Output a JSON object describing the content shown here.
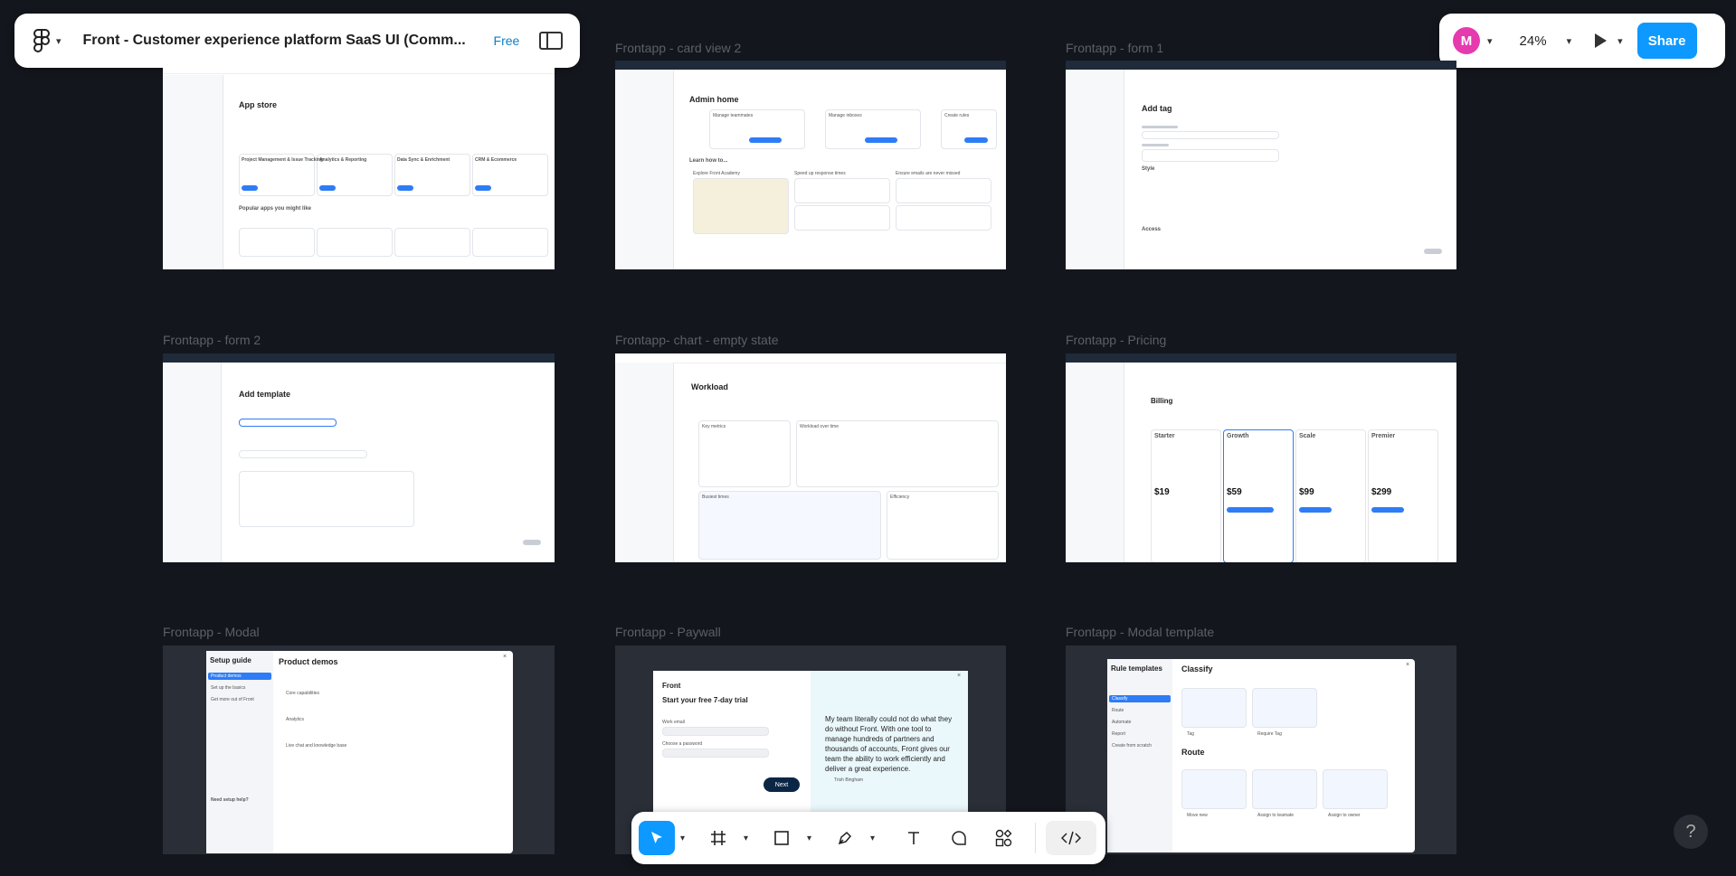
{
  "file": {
    "name": "Front - Customer experience platform SaaS UI (Comm...",
    "plan_badge": "Free"
  },
  "toolbar_right": {
    "avatar_initial": "M",
    "avatar_color": "#e63aaf",
    "zoom": "24%",
    "share_label": "Share"
  },
  "frames": [
    {
      "label": "Frontapp - card view 2"
    },
    {
      "label": "Frontapp - form 1"
    },
    {
      "label": "Frontapp - form 2"
    },
    {
      "label": "Frontapp- chart - empty state"
    },
    {
      "label": "Frontapp - Pricing"
    },
    {
      "label": "Frontapp - Modal"
    },
    {
      "label": "Frontapp - Paywall"
    },
    {
      "label": "Frontapp - Modal template"
    }
  ],
  "thumbs": {
    "app_store": {
      "title": "App store",
      "cats": [
        "Project Management & Issue Tracking",
        "Analytics & Reporting",
        "Data Sync & Enrichment",
        "CRM & Ecommerce"
      ],
      "popular": "Popular apps you might like"
    },
    "card_view": {
      "title": "Admin home",
      "cards": [
        "Manage teammates",
        "Manage inboxes",
        "Create rules"
      ],
      "learn": "Learn how to...",
      "col1": "Explore Front Academy",
      "col2": "Speed up response times",
      "col3": "Ensure emails are never missed"
    },
    "form1": {
      "title": "Add tag",
      "style": "Style",
      "access": "Access"
    },
    "form2": {
      "title": "Add template"
    },
    "chart": {
      "title": "Workload",
      "left": "Key metrics",
      "right": "Workload over time",
      "bottom1": "Busiest times",
      "bottom2": "Efficiency"
    },
    "pricing": {
      "title": "Billing",
      "plans": [
        "Starter",
        "Growth",
        "Scale",
        "Premier"
      ],
      "prices": [
        "$19",
        "$59",
        "$99",
        "$299"
      ]
    },
    "modal": {
      "side_title": "Setup guide",
      "items": [
        "Product demos",
        "Set up the basics",
        "Get more out of Front"
      ],
      "main_title": "Product demos",
      "rows": [
        "Core capabilities",
        "Analytics",
        "Live chat and knowledge base"
      ],
      "help": "Need setup help?"
    },
    "paywall": {
      "brand": "Front",
      "title": "Start your free 7-day trial",
      "work_email": "Work email",
      "choose_password": "Choose a password",
      "next": "Next",
      "quote": "My team literally could not do what they do without Front. With one tool to manage hundreds of partners and thousands of accounts, Front gives our team the ability to work efficiently and deliver a great experience.",
      "person": "Trish Bingham"
    },
    "modal_template": {
      "side_title": "Rule templates",
      "side_items": [
        "Classify",
        "Route",
        "Automate",
        "Report",
        "Create from scratch"
      ],
      "section1": "Classify",
      "tiles1": [
        "Tag",
        "Require Tag"
      ],
      "section2": "Route",
      "tiles2": [
        "Move new",
        "Assign to teamate",
        "Assign to owner"
      ]
    }
  },
  "help_label": "?"
}
